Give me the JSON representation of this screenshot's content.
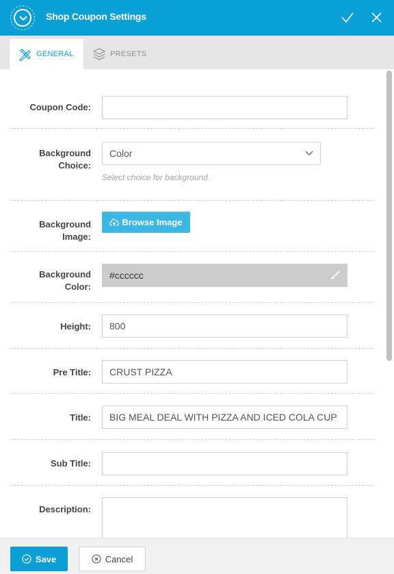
{
  "header": {
    "title": "Shop Coupon Settings",
    "accent": "#0aa0d6"
  },
  "tabs": [
    {
      "label": "GENERAL",
      "icon": "pencil-ruler-icon",
      "active": true
    },
    {
      "label": "PRESETS",
      "icon": "layers-icon",
      "active": false
    }
  ],
  "fields": {
    "coupon_code": {
      "label": "Coupon Code:",
      "value": ""
    },
    "background_choice": {
      "label_line1": "Background",
      "label_line2": "Choice:",
      "value": "Color",
      "help": "Select choice for background."
    },
    "background_image": {
      "label_line1": "Background",
      "label_line2": "Image:",
      "button": "Browse Image"
    },
    "background_color": {
      "label_line1": "Background",
      "label_line2": "Color:",
      "value": "#cccccc"
    },
    "height": {
      "label": "Height:",
      "value": "800"
    },
    "pre_title": {
      "label": "Pre Title:",
      "value": "CRUST PIZZA"
    },
    "title": {
      "label": "Title:",
      "value": "BIG MEAL DEAL WITH PIZZA AND ICED COLA CUP"
    },
    "sub_title": {
      "label": "Sub Title:",
      "value": ""
    },
    "description": {
      "label": "Description:",
      "value": ""
    }
  },
  "footer": {
    "save_label": "Save",
    "cancel_label": "Cancel"
  }
}
